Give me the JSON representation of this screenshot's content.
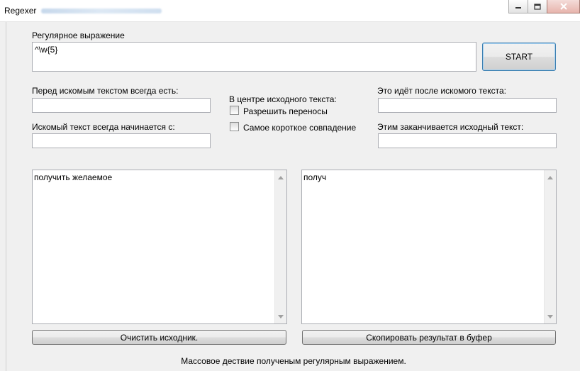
{
  "window": {
    "title": "Regexer",
    "icons": {
      "minimize": "minimize-icon",
      "restore": "restore-icon",
      "close": "close-icon"
    }
  },
  "regex": {
    "label": "Регулярное выражение",
    "value": "^\\w{5}"
  },
  "start_button": "START",
  "before": {
    "label": "Перед искомым текстом всегда есть:",
    "value": ""
  },
  "starts_with": {
    "label": "Искомый текст всегда начинается с:",
    "value": ""
  },
  "center": {
    "label": "В центре исходного текста:",
    "allow_wrap_label": "Разрешить переносы",
    "allow_wrap_checked": false,
    "shortest_label": "Самое короткое совпадение",
    "shortest_checked": false
  },
  "after": {
    "label": "Это идёт после искомого текста:",
    "value": ""
  },
  "ends_with": {
    "label": "Этим заканчивается исходный текст:",
    "value": ""
  },
  "source_text": "получить желаемое",
  "result_text": "получ",
  "clear_button": "Очистить исходник.",
  "copy_button": "Скопировать результат в буфер",
  "status": "Массовое дествие полученым регулярным выражением."
}
